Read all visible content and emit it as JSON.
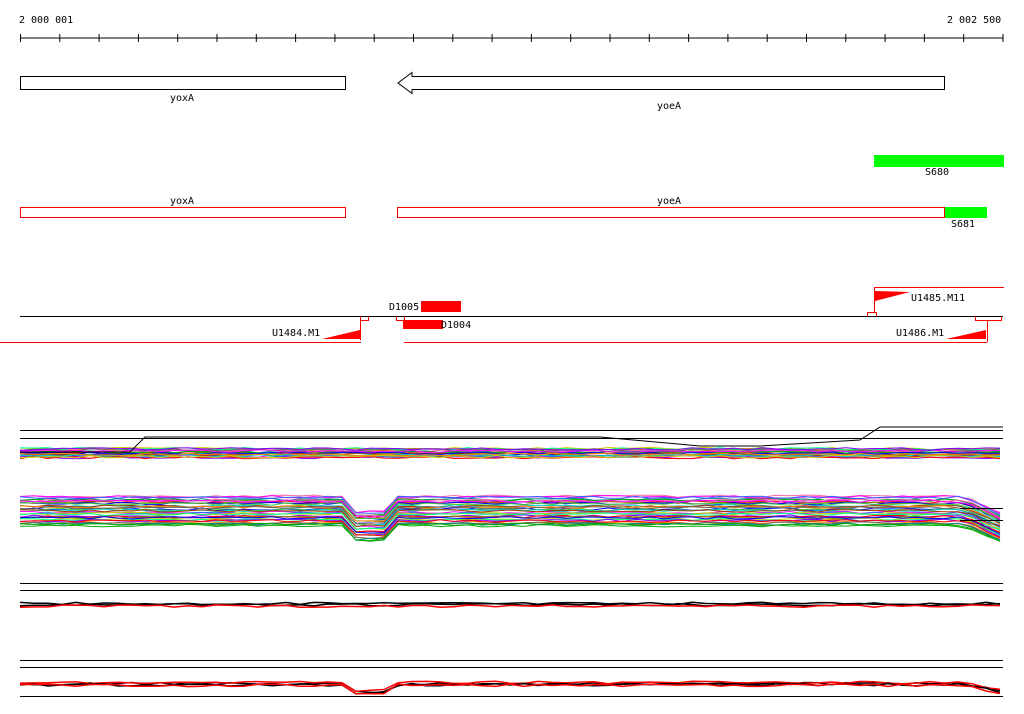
{
  "ruler": {
    "start": "2 000 001",
    "end": "2 002 500"
  },
  "genes": [
    {
      "label": "yoxA"
    },
    {
      "label": "yoeA"
    }
  ],
  "green_features": [
    {
      "label": "S680"
    },
    {
      "label": "S681"
    }
  ],
  "annotation_boxes": [
    {
      "label": "yoxA"
    },
    {
      "label": "yoeA"
    }
  ],
  "features": [
    {
      "label": "D1005"
    },
    {
      "label": "D1004"
    },
    {
      "label": "U1484.M1"
    },
    {
      "label": "U1485.M11"
    },
    {
      "label": "U1486.M1"
    }
  ],
  "colors": {
    "red": "#ff0000",
    "green": "#00ff00",
    "black": "#000000"
  }
}
